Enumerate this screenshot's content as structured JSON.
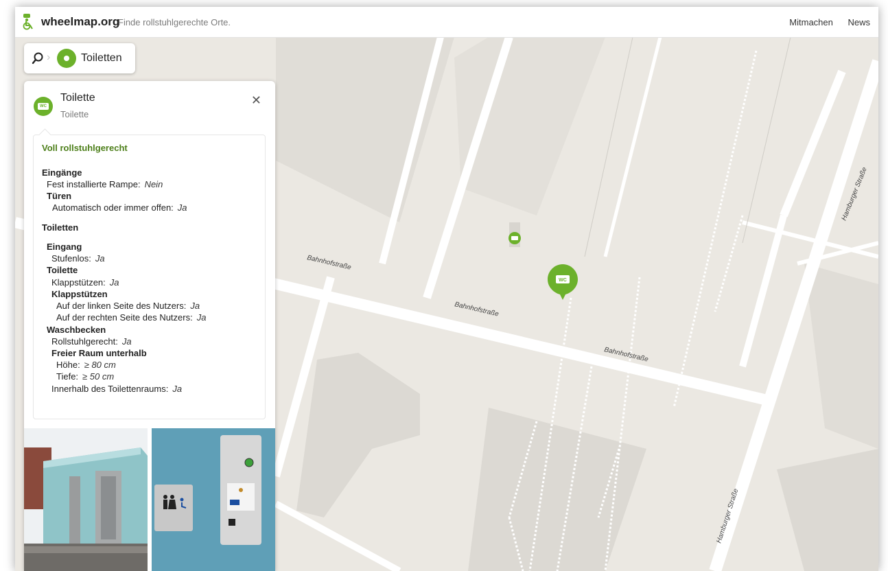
{
  "header": {
    "logo": "wheelmap.org",
    "tagline": "Finde rollstuhlgerechte Orte.",
    "nav": [
      "Mitmachen",
      "News"
    ]
  },
  "search": {
    "category": "Toiletten"
  },
  "panel": {
    "title": "Toilette",
    "subtitle": "Toilette",
    "status": "Voll rollstuhlgerecht",
    "lines": [
      {
        "text": "Eingänge",
        "bold": true
      },
      {
        "text": "Fest installierte Rampe:",
        "value": "Nein"
      },
      {
        "text": "Türen",
        "bold": true
      },
      {
        "text": "Automatisch oder immer offen:",
        "value": "Ja"
      },
      {
        "text": "Toiletten",
        "bold": true
      },
      {
        "text": "Eingang",
        "bold": true
      },
      {
        "text": "Stufenlos:",
        "value": "Ja"
      },
      {
        "text": "Toilette",
        "bold": true
      },
      {
        "text": "Klappstützen:",
        "value": "Ja"
      },
      {
        "text": "Klappstützen",
        "bold": true
      },
      {
        "text": "Auf der linken Seite des Nutzers:",
        "value": "Ja"
      },
      {
        "text": "Auf der rechten Seite des Nutzers:",
        "value": "Ja"
      },
      {
        "text": "Waschbecken",
        "bold": true
      },
      {
        "text": "Rollstuhlgerecht:",
        "value": "Ja"
      },
      {
        "text": "Freier Raum unterhalb",
        "bold": true
      },
      {
        "text": "Höhe:",
        "value": "≥ 80 cm"
      },
      {
        "text": "Tiefe:",
        "value": "≥ 50 cm"
      },
      {
        "text": "Innerhalb des Toilettenraums:",
        "value": "Ja"
      }
    ]
  },
  "map": {
    "streets": [
      "Bahnhofstraße",
      "Bahnhofstraße",
      "Bahnhofstraße",
      "Hamburger Straße",
      "Hamburger Straße"
    ],
    "marker_label": "WC"
  },
  "colors": {
    "accent": "#6cb12b",
    "status_text": "#4d7f1a",
    "map_bg": "#ebe8e2",
    "road": "#ffffff"
  }
}
